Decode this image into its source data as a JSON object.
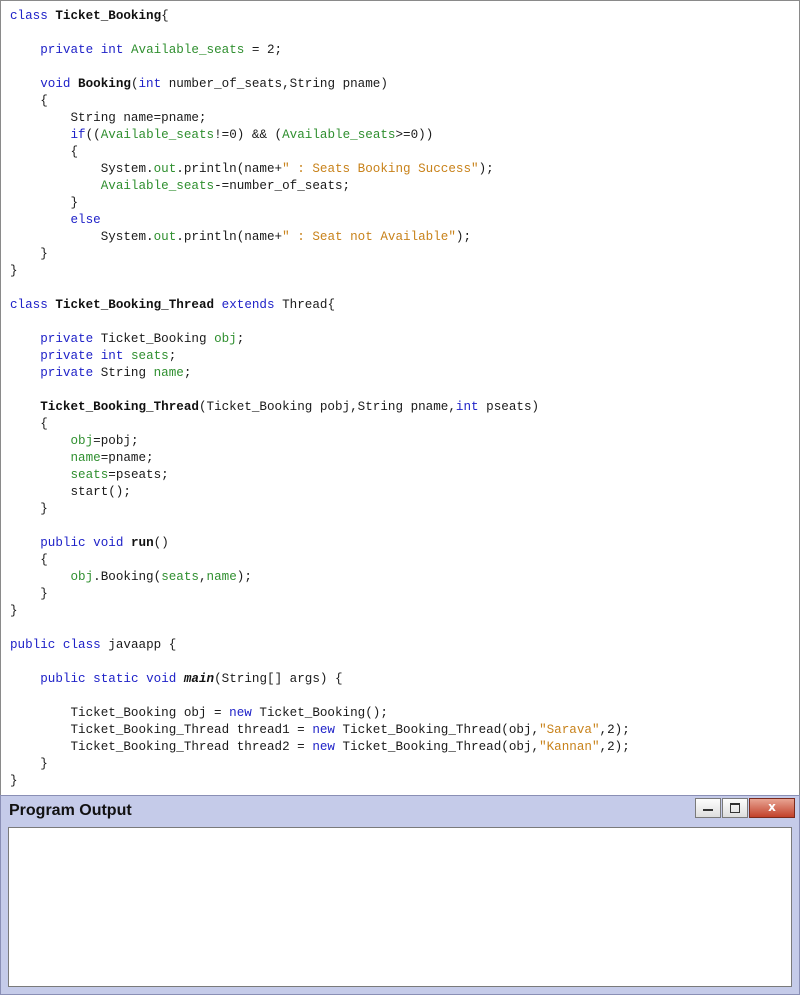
{
  "editor": {
    "lines": [
      [
        [
          "kw",
          "class"
        ],
        [
          "plain",
          " "
        ],
        [
          "ident",
          "Ticket_Booking"
        ],
        [
          "plain",
          "{"
        ]
      ],
      [],
      [
        [
          "plain",
          "    "
        ],
        [
          "kw",
          "private"
        ],
        [
          "plain",
          " "
        ],
        [
          "kw",
          "int"
        ],
        [
          "plain",
          " "
        ],
        [
          "field",
          "Available_seats"
        ],
        [
          "plain",
          " = 2;"
        ]
      ],
      [],
      [
        [
          "plain",
          "    "
        ],
        [
          "kw",
          "void"
        ],
        [
          "plain",
          " "
        ],
        [
          "ident",
          "Booking"
        ],
        [
          "plain",
          "("
        ],
        [
          "kw",
          "int"
        ],
        [
          "plain",
          " number_of_seats,String pname)"
        ]
      ],
      [
        [
          "plain",
          "    {"
        ]
      ],
      [
        [
          "plain",
          "        String name=pname;"
        ]
      ],
      [
        [
          "plain",
          "        "
        ],
        [
          "kw",
          "if"
        ],
        [
          "plain",
          "(("
        ],
        [
          "field",
          "Available_seats"
        ],
        [
          "plain",
          "!=0) && ("
        ],
        [
          "field",
          "Available_seats"
        ],
        [
          "plain",
          ">=0))"
        ]
      ],
      [
        [
          "plain",
          "        {"
        ]
      ],
      [
        [
          "plain",
          "            System."
        ],
        [
          "field",
          "out"
        ],
        [
          "plain",
          ".println(name+"
        ],
        [
          "str",
          "\" : Seats Booking Success\""
        ],
        [
          "plain",
          ");"
        ]
      ],
      [
        [
          "plain",
          "            "
        ],
        [
          "field",
          "Available_seats"
        ],
        [
          "plain",
          "-=number_of_seats;"
        ]
      ],
      [
        [
          "plain",
          "        }"
        ]
      ],
      [
        [
          "plain",
          "        "
        ],
        [
          "kw",
          "else"
        ]
      ],
      [
        [
          "plain",
          "            System."
        ],
        [
          "field",
          "out"
        ],
        [
          "plain",
          ".println(name+"
        ],
        [
          "str",
          "\" : Seat not Available\""
        ],
        [
          "plain",
          ");"
        ]
      ],
      [
        [
          "plain",
          "    }"
        ]
      ],
      [
        [
          "plain",
          "}"
        ]
      ],
      [],
      [
        [
          "kw",
          "class"
        ],
        [
          "plain",
          " "
        ],
        [
          "ident",
          "Ticket_Booking_Thread"
        ],
        [
          "plain",
          " "
        ],
        [
          "kw",
          "extends"
        ],
        [
          "plain",
          " Thread{"
        ]
      ],
      [],
      [
        [
          "plain",
          "    "
        ],
        [
          "kw",
          "private"
        ],
        [
          "plain",
          " Ticket_Booking "
        ],
        [
          "field",
          "obj"
        ],
        [
          "plain",
          ";"
        ]
      ],
      [
        [
          "plain",
          "    "
        ],
        [
          "kw",
          "private"
        ],
        [
          "plain",
          " "
        ],
        [
          "kw",
          "int"
        ],
        [
          "plain",
          " "
        ],
        [
          "field",
          "seats"
        ],
        [
          "plain",
          ";"
        ]
      ],
      [
        [
          "plain",
          "    "
        ],
        [
          "kw",
          "private"
        ],
        [
          "plain",
          " String "
        ],
        [
          "field",
          "name"
        ],
        [
          "plain",
          ";"
        ]
      ],
      [],
      [
        [
          "plain",
          "    "
        ],
        [
          "ident",
          "Ticket_Booking_Thread"
        ],
        [
          "plain",
          "(Ticket_Booking pobj,String pname,"
        ],
        [
          "kw",
          "int"
        ],
        [
          "plain",
          " pseats)"
        ]
      ],
      [
        [
          "plain",
          "    {"
        ]
      ],
      [
        [
          "plain",
          "        "
        ],
        [
          "field",
          "obj"
        ],
        [
          "plain",
          "=pobj;"
        ]
      ],
      [
        [
          "plain",
          "        "
        ],
        [
          "field",
          "name"
        ],
        [
          "plain",
          "=pname;"
        ]
      ],
      [
        [
          "plain",
          "        "
        ],
        [
          "field",
          "seats"
        ],
        [
          "plain",
          "=pseats;"
        ]
      ],
      [
        [
          "plain",
          "        start();"
        ]
      ],
      [
        [
          "plain",
          "    }"
        ]
      ],
      [],
      [
        [
          "plain",
          "    "
        ],
        [
          "kw",
          "public"
        ],
        [
          "plain",
          " "
        ],
        [
          "kw",
          "void"
        ],
        [
          "plain",
          " "
        ],
        [
          "ident",
          "run"
        ],
        [
          "plain",
          "()"
        ]
      ],
      [
        [
          "plain",
          "    {"
        ]
      ],
      [
        [
          "plain",
          "        "
        ],
        [
          "field",
          "obj"
        ],
        [
          "plain",
          ".Booking("
        ],
        [
          "field",
          "seats"
        ],
        [
          "plain",
          ","
        ],
        [
          "field",
          "name"
        ],
        [
          "plain",
          ");"
        ]
      ],
      [
        [
          "plain",
          "    }"
        ]
      ],
      [
        [
          "plain",
          "}"
        ]
      ],
      [],
      [
        [
          "kw",
          "public"
        ],
        [
          "plain",
          " "
        ],
        [
          "kw",
          "class"
        ],
        [
          "plain",
          " javaapp {"
        ]
      ],
      [],
      [
        [
          "plain",
          "    "
        ],
        [
          "kw",
          "public"
        ],
        [
          "plain",
          " "
        ],
        [
          "kw",
          "static"
        ],
        [
          "plain",
          " "
        ],
        [
          "kw",
          "void"
        ],
        [
          "plain",
          " "
        ],
        [
          "italic",
          "main"
        ],
        [
          "plain",
          "(String[] args) {"
        ]
      ],
      [],
      [
        [
          "plain",
          "        Ticket_Booking obj = "
        ],
        [
          "kw",
          "new"
        ],
        [
          "plain",
          " Ticket_Booking();"
        ]
      ],
      [
        [
          "plain",
          "        Ticket_Booking_Thread thread1 = "
        ],
        [
          "kw",
          "new"
        ],
        [
          "plain",
          " Ticket_Booking_Thread(obj,"
        ],
        [
          "str",
          "\"Sarava\""
        ],
        [
          "plain",
          ",2);"
        ]
      ],
      [
        [
          "plain",
          "        Ticket_Booking_Thread thread2 = "
        ],
        [
          "kw",
          "new"
        ],
        [
          "plain",
          " Ticket_Booking_Thread(obj,"
        ],
        [
          "str",
          "\"Kannan\""
        ],
        [
          "plain",
          ",2);"
        ]
      ],
      [
        [
          "plain",
          "    }"
        ]
      ],
      [
        [
          "plain",
          "}"
        ]
      ]
    ]
  },
  "output_panel": {
    "title": "Program Output",
    "close_label": "x",
    "output_text": ""
  }
}
